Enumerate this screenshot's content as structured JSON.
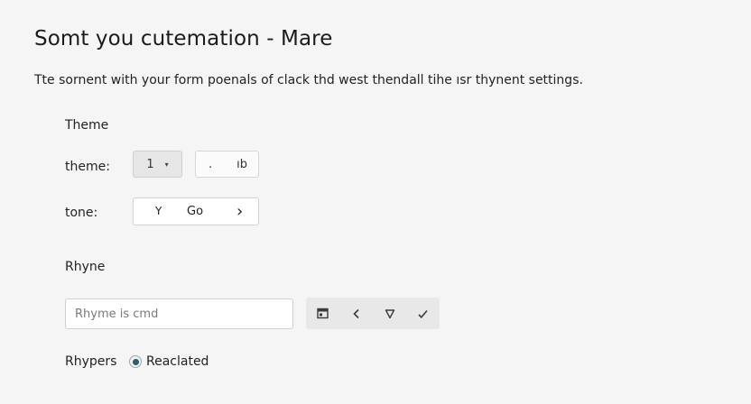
{
  "header": {
    "title": "Somt you cutemation - Mare",
    "subtitle": "Tte sornent with your form poenals of clack thd west thendall tihe ısr thynent settings."
  },
  "theme_section": {
    "heading": "Theme",
    "theme_label": "theme:",
    "theme_button_a": "1",
    "theme_button_a_caret": "▾",
    "theme_button_b_left": ".",
    "theme_button_b_right": "ıb",
    "tone_label": "tone:",
    "tone_left_glyph": "Y",
    "tone_value": "Go",
    "tone_right_glyph": "›"
  },
  "rhyme_section": {
    "heading": "Rhyne",
    "input_placeholder": "Rhyme is cmd",
    "toolbar_icons": [
      "calendar-icon",
      "chevron-left-icon",
      "shield-icon",
      "check-icon"
    ]
  },
  "rhypers": {
    "label": "Rhypers",
    "option_label": "Reaclated",
    "selected": true
  },
  "colors": {
    "background": "#f5f5f5",
    "radio_accent": "#2b5d72",
    "toolbar_bg": "#e8e8e8"
  }
}
